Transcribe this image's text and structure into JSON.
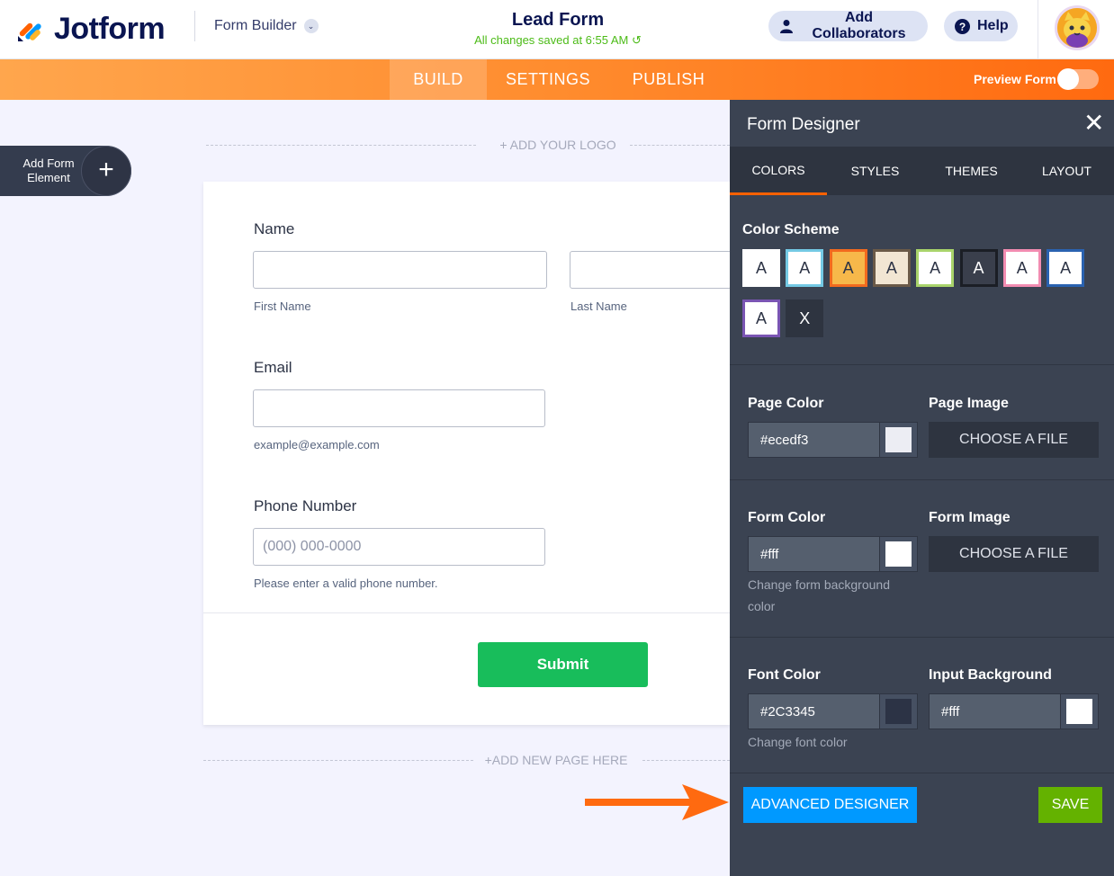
{
  "header": {
    "brand": "Jotform",
    "builder_label": "Form Builder",
    "form_title": "Lead Form",
    "saved_status": "All changes saved at 6:55 AM",
    "collab_label": "Add Collaborators",
    "help_label": "Help"
  },
  "nav": {
    "tabs": [
      "BUILD",
      "SETTINGS",
      "PUBLISH"
    ],
    "preview_label": "Preview Form"
  },
  "canvas": {
    "add_element_label": "Add Form Element",
    "add_logo": "+ ADD YOUR LOGO",
    "add_page": "+ADD NEW PAGE HERE"
  },
  "form": {
    "name_label": "Name",
    "first_name_sub": "First Name",
    "last_name_sub": "Last Name",
    "email_label": "Email",
    "email_sub": "example@example.com",
    "phone_label": "Phone Number",
    "phone_placeholder": "(000) 000-0000",
    "phone_sub": "Please enter a valid phone number.",
    "submit_label": "Submit"
  },
  "designer": {
    "title": "Form Designer",
    "tabs": [
      "COLORS",
      "STYLES",
      "THEMES",
      "LAYOUT"
    ],
    "color_scheme_title": "Color Scheme",
    "swatches": [
      {
        "label": "A",
        "bg": "#ffffff",
        "border": "#ffffff",
        "text": "#2c3345"
      },
      {
        "label": "A",
        "bg": "#ffffff",
        "border": "#74c9e4",
        "text": "#2c3345"
      },
      {
        "label": "A",
        "bg": "#f7b84a",
        "border": "#f26a1e",
        "text": "#2c3345"
      },
      {
        "label": "A",
        "bg": "#f2e6d3",
        "border": "#6b5a48",
        "text": "#2c3345"
      },
      {
        "label": "A",
        "bg": "#ffffff",
        "border": "#a9d46b",
        "text": "#2c3345"
      },
      {
        "label": "A",
        "bg": "#3a3f4c",
        "border": "#1b1e25",
        "text": "#ffffff"
      },
      {
        "label": "A",
        "bg": "#ffffff",
        "border": "#f28cb1",
        "text": "#2c3345"
      },
      {
        "label": "A",
        "bg": "#ffffff",
        "border": "#2a62b0",
        "text": "#2c3345"
      },
      {
        "label": "A",
        "bg": "#ffffff",
        "border": "#7a55b3",
        "text": "#2c3345"
      },
      {
        "label": "X",
        "bg": "#2e3440",
        "border": "#2e3440",
        "text": "#ffffff"
      }
    ],
    "page_color_label": "Page Color",
    "page_color_value": "#ecedf3",
    "page_image_label": "Page Image",
    "choose_file": "CHOOSE A FILE",
    "form_color_label": "Form Color",
    "form_color_value": "#fff",
    "form_color_help": "Change form background color",
    "form_image_label": "Form Image",
    "font_color_label": "Font Color",
    "font_color_value": "#2C3345",
    "font_color_help": "Change font color",
    "input_bg_label": "Input Background",
    "input_bg_value": "#fff",
    "advanced_label": "ADVANCED DESIGNER",
    "save_label": "SAVE"
  },
  "colors": {
    "accent_orange": "#ff6100",
    "submit_green": "#18bd5b",
    "advanced_blue": "#0099ff",
    "save_green": "#64b200"
  }
}
